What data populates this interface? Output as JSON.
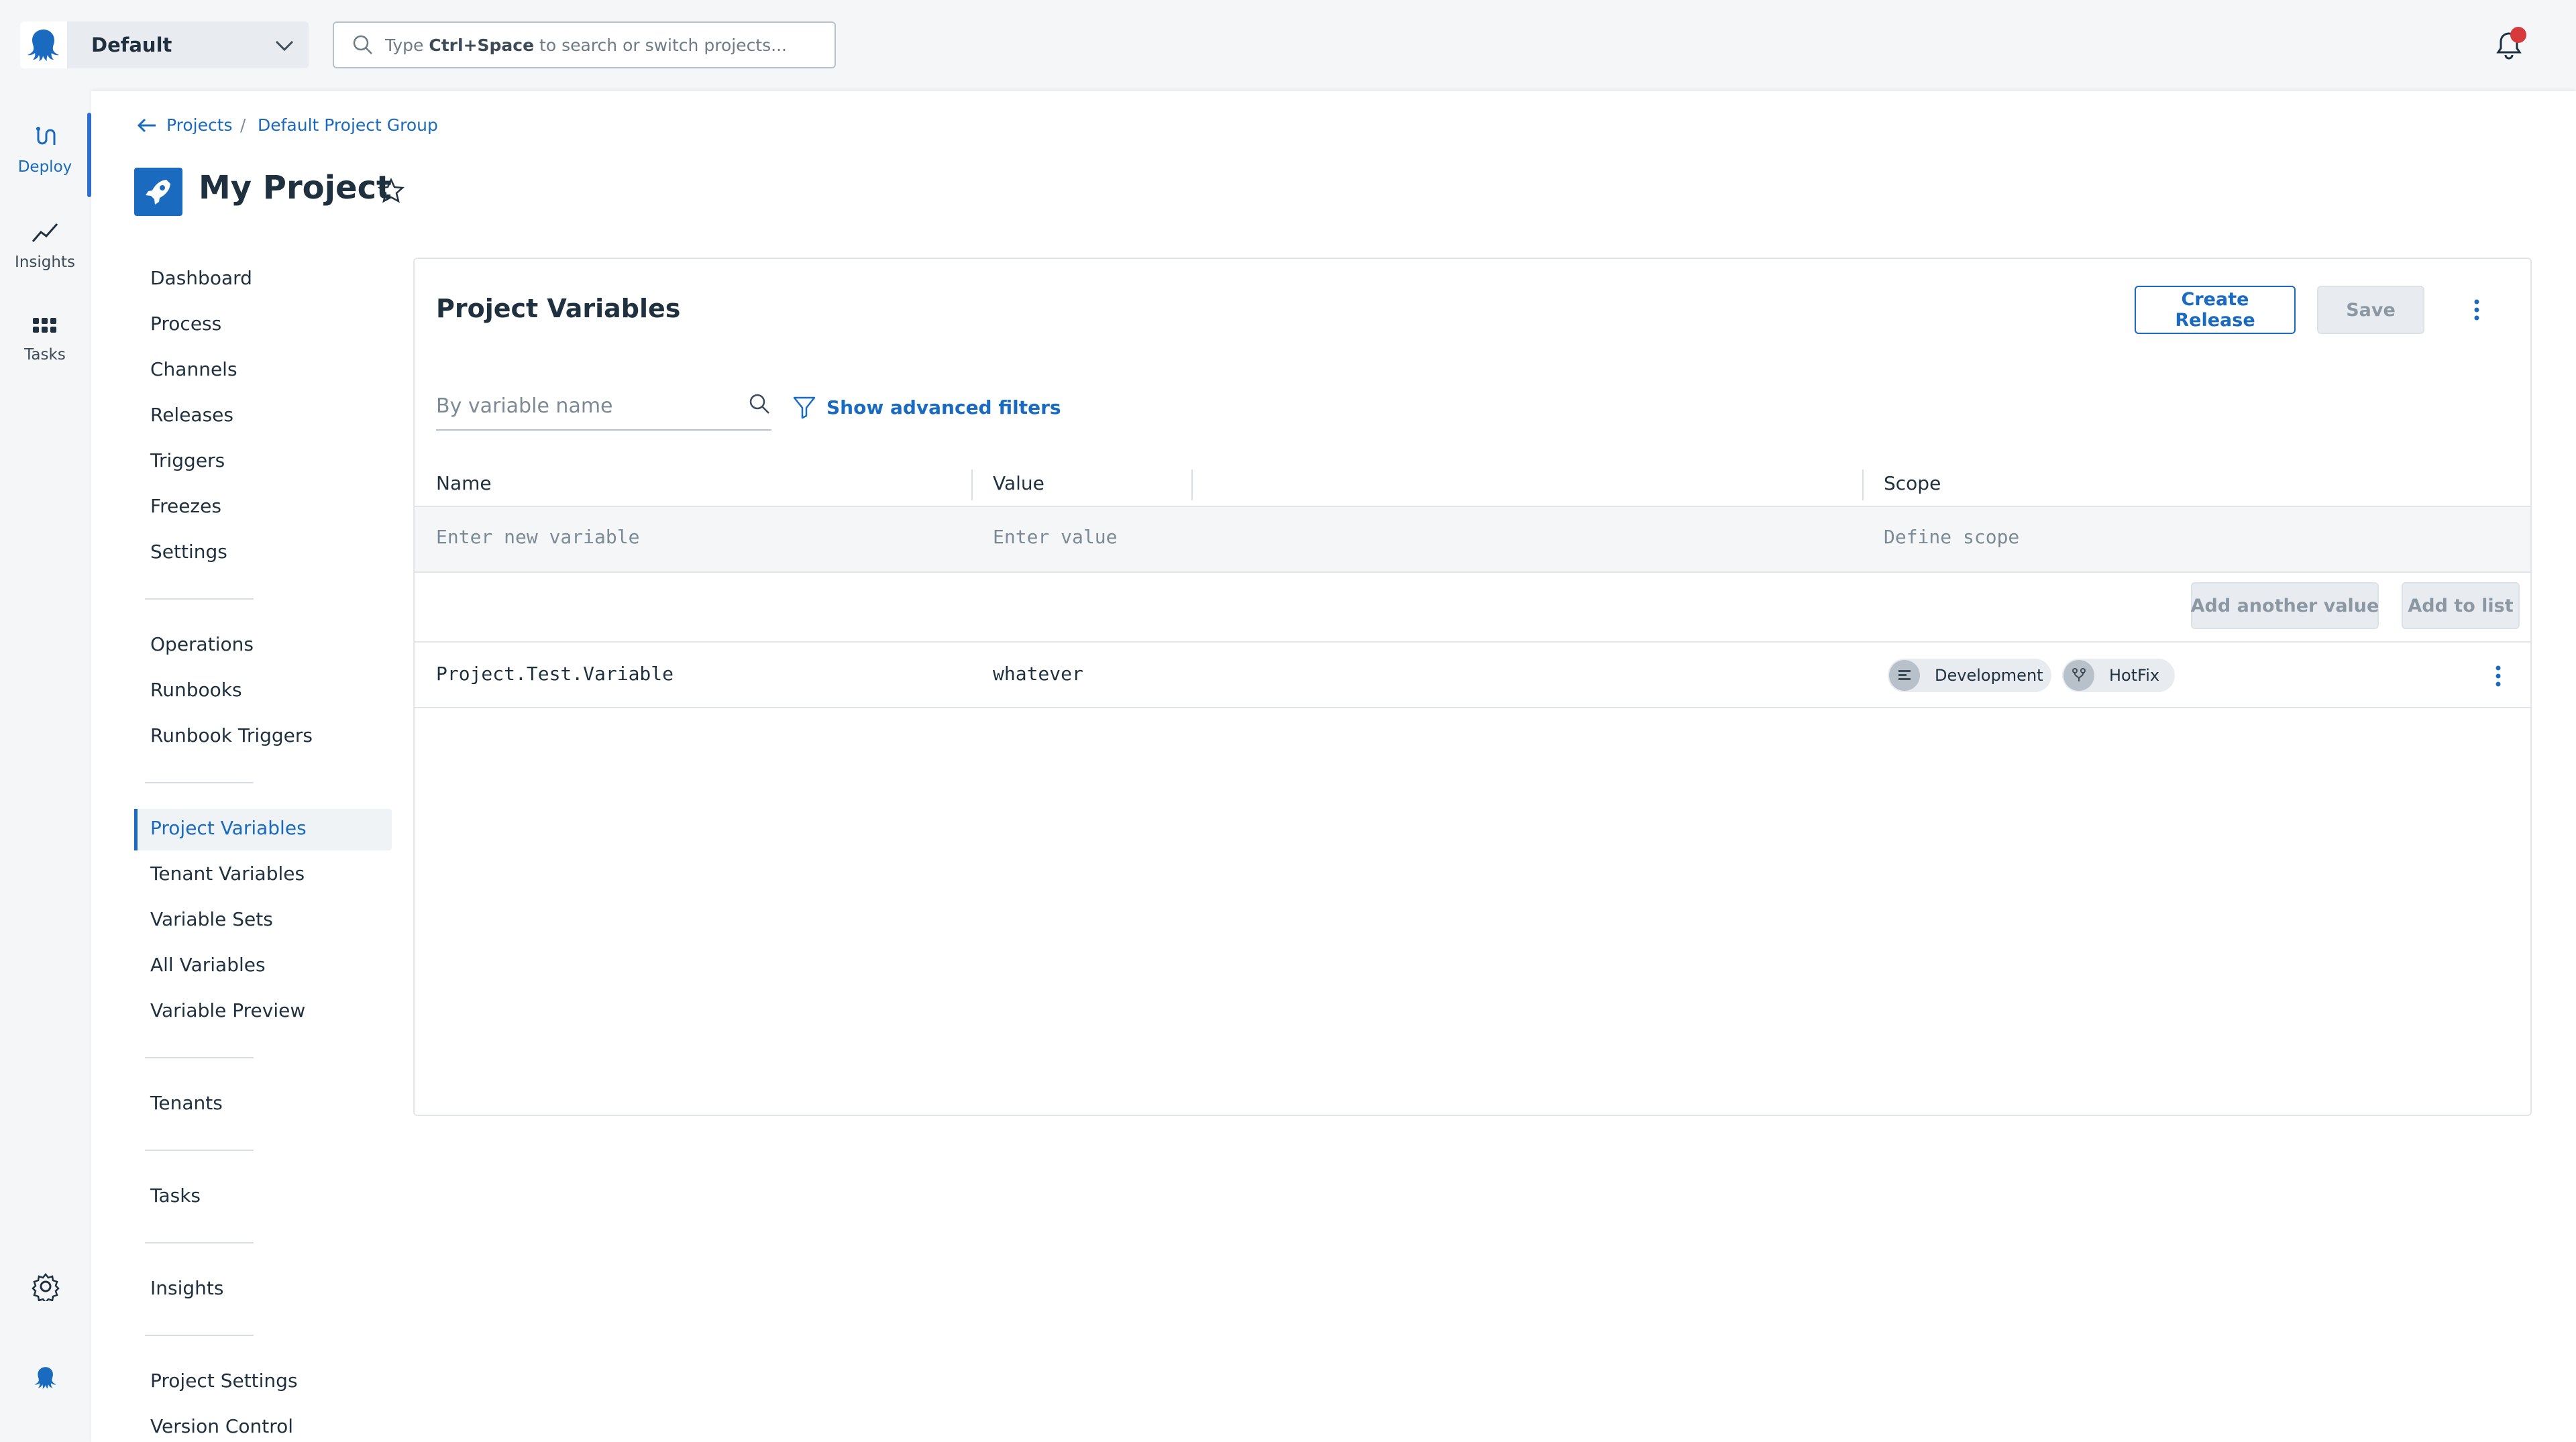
{
  "topbar": {
    "space_name": "Default",
    "search_placeholder_prefix": "Type",
    "search_placeholder_key": "Ctrl+Space",
    "search_placeholder_suffix": "to search or switch projects..."
  },
  "rail": {
    "items": [
      {
        "label": "Deploy",
        "icon": "deploy-icon",
        "active": true
      },
      {
        "label": "Insights",
        "icon": "insights-icon",
        "active": false
      },
      {
        "label": "Tasks",
        "icon": "tasks-icon",
        "active": false
      }
    ]
  },
  "breadcrumb": {
    "projects": "Projects",
    "separator": "/",
    "group": "Default Project Group"
  },
  "project": {
    "title": "My Project"
  },
  "nav": {
    "group1": [
      "Dashboard",
      "Process",
      "Channels",
      "Releases",
      "Triggers",
      "Freezes",
      "Settings"
    ],
    "group2": [
      "Operations",
      "Runbooks",
      "Runbook Triggers"
    ],
    "group3": [
      "Project Variables",
      "Tenant Variables",
      "Variable Sets",
      "All Variables",
      "Variable Preview"
    ],
    "group4": [
      "Tenants"
    ],
    "group5": [
      "Tasks"
    ],
    "group6": [
      "Insights"
    ],
    "group7": [
      "Project Settings",
      "Version Control"
    ],
    "active": "Project Variables"
  },
  "card": {
    "title": "Project Variables",
    "create_release": "Create Release",
    "save": "Save",
    "filter_placeholder": "By variable name",
    "advanced_filters": "Show advanced filters",
    "columns": {
      "name": "Name",
      "value": "Value",
      "scope": "Scope"
    },
    "new_row": {
      "name_placeholder": "Enter new variable",
      "value_placeholder": "Enter value",
      "scope_placeholder": "Define scope"
    },
    "add_another_value": "Add another value",
    "add_to_list": "Add to list",
    "variables": [
      {
        "name": "Project.Test.Variable",
        "value": "whatever",
        "scopes": [
          {
            "label": "Development",
            "icon": "environment-icon"
          },
          {
            "label": "HotFix",
            "icon": "channel-icon"
          }
        ]
      }
    ]
  },
  "colors": {
    "accent": "#1a6bbf",
    "notification": "#d63a3a"
  }
}
